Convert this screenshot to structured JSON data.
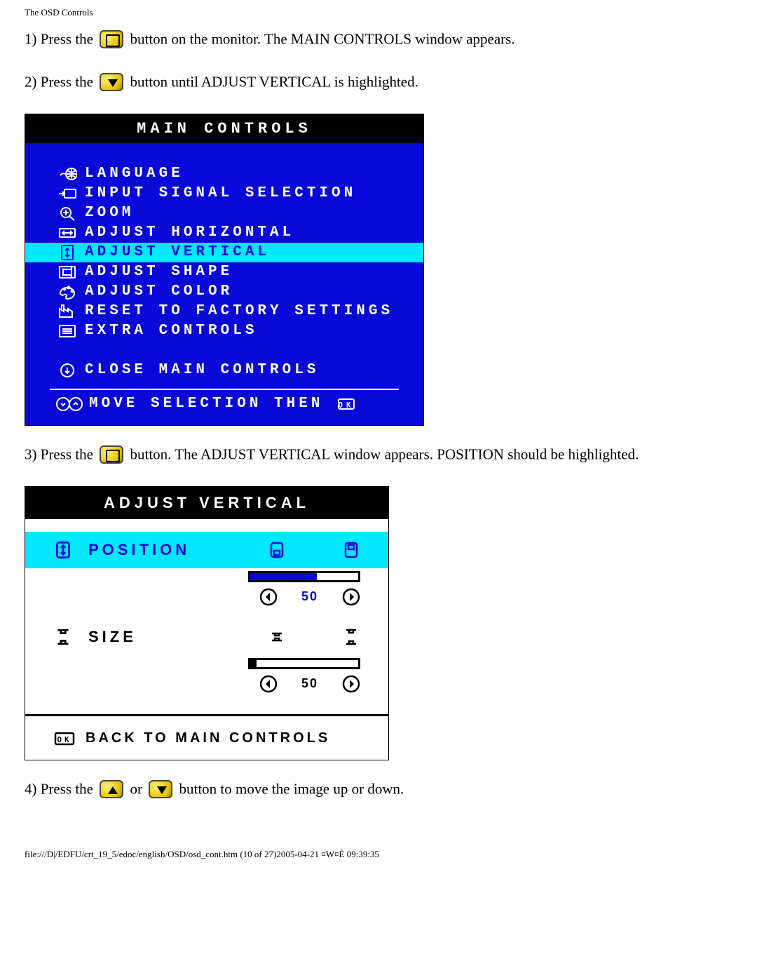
{
  "header": {
    "title": "The OSD Controls"
  },
  "instructions": {
    "step1_a": "1) Press the ",
    "step1_b": " button on the monitor. The MAIN CONTROLS window appears.",
    "step2_a": "2) Press the ",
    "step2_b": " button until ADJUST VERTICAL is highlighted.",
    "step3_a": "3) Press the ",
    "step3_b": " button. The ADJUST VERTICAL window appears. POSITION should be highlighted.",
    "step4_a": "4) Press the ",
    "step4_b": " or ",
    "step4_c": " button to move the image up or down."
  },
  "osd_main": {
    "title": "MAIN CONTROLS",
    "items": [
      {
        "label": "LANGUAGE",
        "icon": "globe",
        "highlighted": false
      },
      {
        "label": "INPUT SIGNAL SELECTION",
        "icon": "input",
        "highlighted": false
      },
      {
        "label": "ZOOM",
        "icon": "zoom",
        "highlighted": false
      },
      {
        "label": "ADJUST HORIZONTAL",
        "icon": "horiz",
        "highlighted": false
      },
      {
        "label": "ADJUST VERTICAL",
        "icon": "vert",
        "highlighted": true
      },
      {
        "label": "ADJUST SHAPE",
        "icon": "shape",
        "highlighted": false
      },
      {
        "label": "ADJUST COLOR",
        "icon": "color",
        "highlighted": false
      },
      {
        "label": "RESET TO FACTORY SETTINGS",
        "icon": "factory",
        "highlighted": false
      },
      {
        "label": "EXTRA CONTROLS",
        "icon": "list",
        "highlighted": false
      }
    ],
    "close_label": "CLOSE MAIN CONTROLS",
    "footer_label": "MOVE SELECTION THEN"
  },
  "adj_vertical": {
    "title": "ADJUST VERTICAL",
    "position": {
      "label": "POSITION",
      "value": "50",
      "fill_pct": 62
    },
    "size": {
      "label": "SIZE",
      "value": "50",
      "fill_pct": 6
    },
    "back_label": "BACK TO MAIN CONTROLS"
  },
  "footer": {
    "text": "file:///D|/EDFU/crt_19_5/edoc/english/OSD/osd_cont.htm (10 of 27)2005-04-21 ¤W¤È 09:39:35"
  }
}
